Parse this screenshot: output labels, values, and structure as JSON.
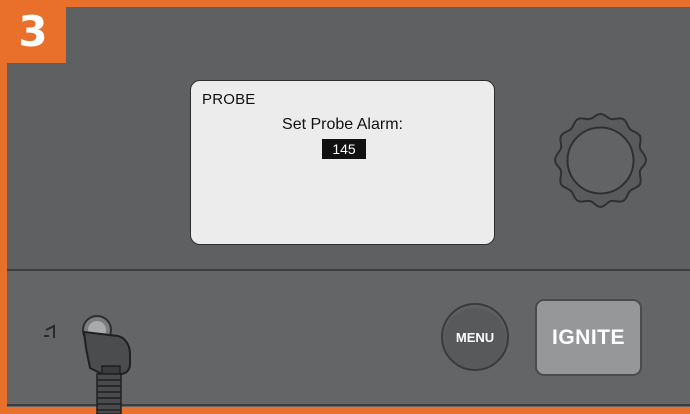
{
  "step": {
    "number": "3"
  },
  "display": {
    "mode_label": "PROBE",
    "prompt": "Set Probe Alarm:",
    "value": "145"
  },
  "controls": {
    "menu_label": "MENU",
    "ignite_label": "IGNITE",
    "knob_icon": "rotary-dial-icon",
    "probe_port_icon": "probe-port-icon"
  },
  "colors": {
    "accent": "#e8702a",
    "panel": "#5f6062",
    "screen": "#ececec",
    "ignite_button": "#969799"
  }
}
